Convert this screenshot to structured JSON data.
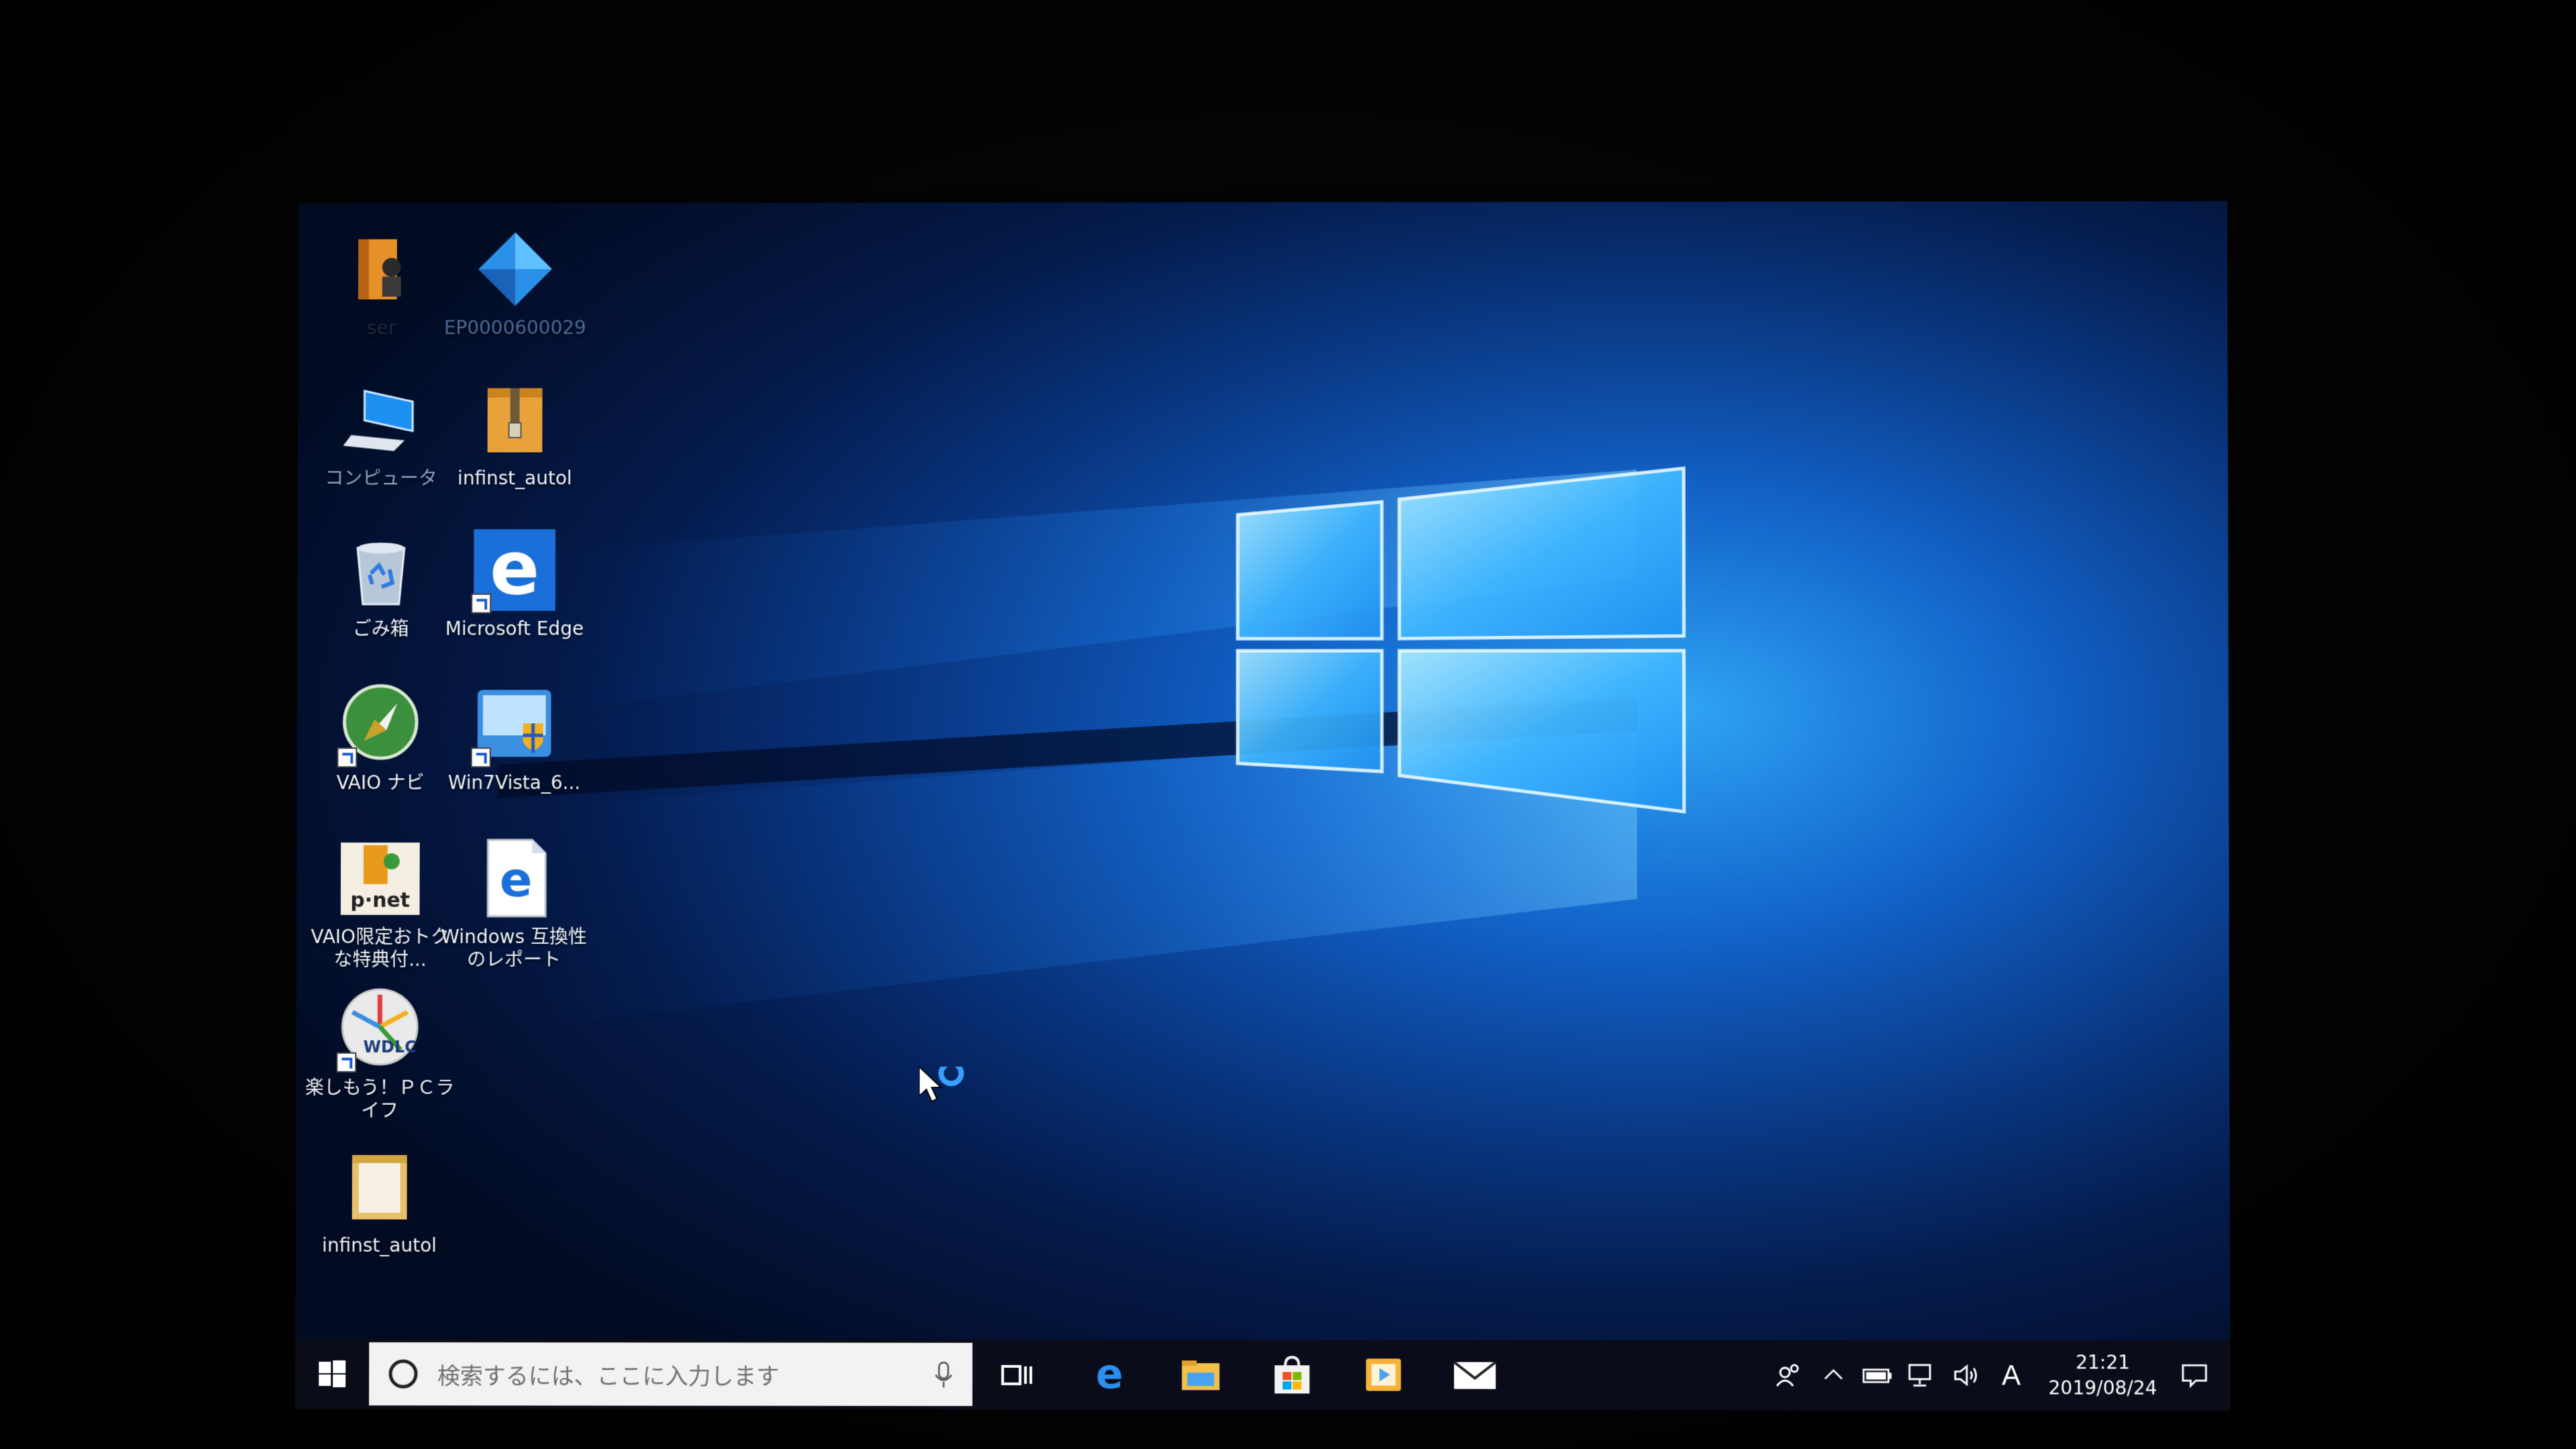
{
  "desktop": {
    "icons": [
      {
        "id": "user-folder",
        "label": "ser"
      },
      {
        "id": "ep-app",
        "label": "EP0000600029"
      },
      {
        "id": "computer",
        "label": "コンピュータ"
      },
      {
        "id": "infinst-zip",
        "label": "infinst_autol"
      },
      {
        "id": "recycle-bin",
        "label": "ごみ箱"
      },
      {
        "id": "edge",
        "label": "Microsoft Edge"
      },
      {
        "id": "vaio-navi",
        "label": "VAIO ナビ"
      },
      {
        "id": "win7vista",
        "label": "Win7Vista_6..."
      },
      {
        "id": "vaio-otoku",
        "label": "VAIO限定おトクな特典付..."
      },
      {
        "id": "compat-report",
        "label": "Windows 互換性のレポート"
      },
      {
        "id": "tanoshimou",
        "label": "楽しもう！ＰＣライフ"
      },
      {
        "id": "infinst-folder",
        "label": "infinst_autol"
      }
    ]
  },
  "taskbar": {
    "search_placeholder": "検索するには、ここに入力します",
    "apps": [
      "task-view",
      "edge",
      "file-explorer",
      "store",
      "media-player",
      "mail"
    ],
    "tray": {
      "ime_label": "A",
      "time": "21:21",
      "date": "2019/08/24"
    }
  },
  "colors": {
    "wallpaper_accent": "#1e9bff",
    "taskbar": "#0a0e18",
    "edge_blue": "#1b6fd8"
  }
}
